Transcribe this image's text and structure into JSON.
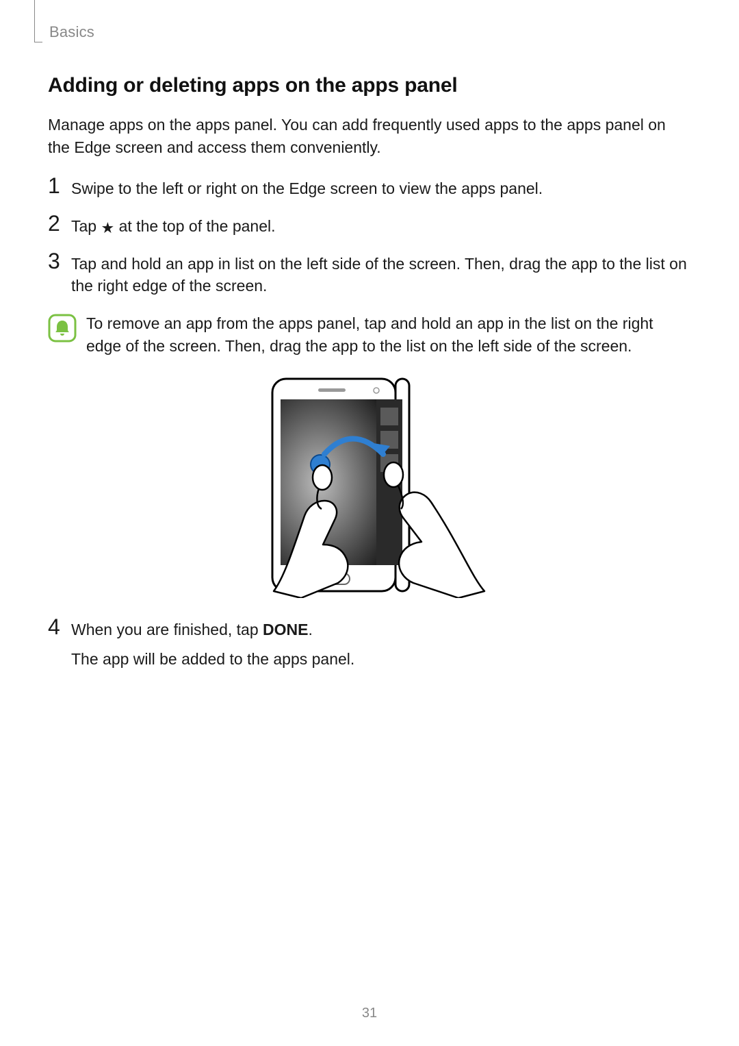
{
  "header": {
    "section": "Basics"
  },
  "title": "Adding or deleting apps on the apps panel",
  "intro": "Manage apps on the apps panel. You can add frequently used apps to the apps panel on the Edge screen and access them conveniently.",
  "steps": {
    "s1": {
      "num": "1",
      "text": "Swipe to the left or right on the Edge screen to view the apps panel."
    },
    "s2": {
      "num": "2",
      "pre": "Tap ",
      "post": " at the top of the panel."
    },
    "s3": {
      "num": "3",
      "text": "Tap and hold an app in list on the left side of the screen. Then, drag the app to the list on the right edge of the screen."
    },
    "s4": {
      "num": "4",
      "pre": "When you are finished, tap ",
      "bold": "DONE",
      "post": ".",
      "sub": "The app will be added to the apps panel."
    }
  },
  "note": {
    "text": "To remove an app from the apps panel, tap and hold an app in the list on the right edge of the screen. Then, drag the app to the list on the left side of the screen."
  },
  "footer": {
    "page": "31"
  }
}
